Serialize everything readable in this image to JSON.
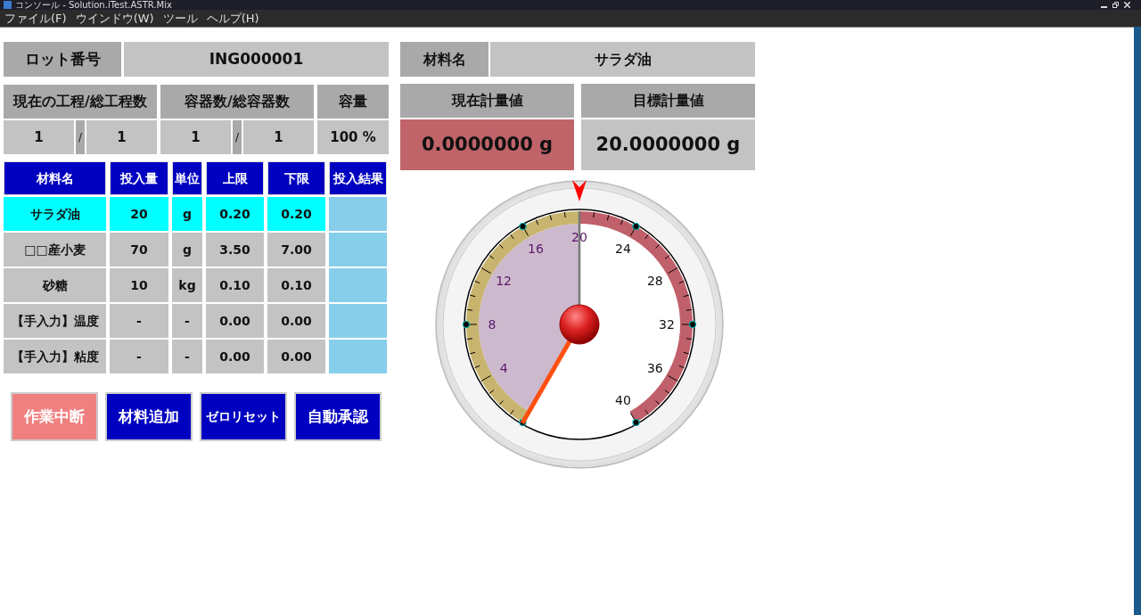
{
  "window": {
    "title": "コンソール - Solution.iTest.ASTR.Mix"
  },
  "menu": [
    "ファイル(F)",
    "ウインドウ(W)",
    "ツール",
    "ヘルプ(H)"
  ],
  "lot": {
    "label": "ロット番号",
    "value": "ING000001"
  },
  "material": {
    "label": "材料名",
    "value": "サラダ油"
  },
  "process": {
    "label": "現在の工程/総工程数",
    "current": "1",
    "separator": "/",
    "total": "1"
  },
  "containers": {
    "label": "容器数/総容器数",
    "current": "1",
    "separator": "/",
    "total": "1"
  },
  "capacity": {
    "label": "容量",
    "value": "100 %"
  },
  "current_weight": {
    "label": "現在計量値",
    "value": "0.0000000 g"
  },
  "target_weight": {
    "label": "目標計量値",
    "value": "20.0000000 g"
  },
  "table": {
    "columns": [
      "材料名",
      "投入量",
      "単位",
      "上限",
      "下限",
      "投入結果"
    ],
    "rows": [
      {
        "cells": [
          "サラダ油",
          "20",
          "g",
          "0.20",
          "0.20"
        ],
        "selected": true
      },
      {
        "cells": [
          "□□産小麦",
          "70",
          "g",
          "3.50",
          "7.00"
        ],
        "selected": false
      },
      {
        "cells": [
          "砂糖",
          "10",
          "kg",
          "0.10",
          "0.10"
        ],
        "selected": false
      },
      {
        "cells": [
          "【手入力】温度",
          "-",
          "-",
          "0.00",
          "0.00"
        ],
        "selected": false
      },
      {
        "cells": [
          "【手入力】粘度",
          "-",
          "-",
          "0.00",
          "0.00"
        ],
        "selected": false
      }
    ]
  },
  "buttons": [
    {
      "label": "作業中断",
      "kind": "warning"
    },
    {
      "label": "材料追加",
      "kind": "primary"
    },
    {
      "label": "ゼロリセット",
      "kind": "primary"
    },
    {
      "label": "自動承認",
      "kind": "primary"
    }
  ],
  "gauge": {
    "labels": [
      "4",
      "8",
      "12",
      "16",
      "20",
      "24",
      "28",
      "32",
      "36",
      "40"
    ]
  }
}
